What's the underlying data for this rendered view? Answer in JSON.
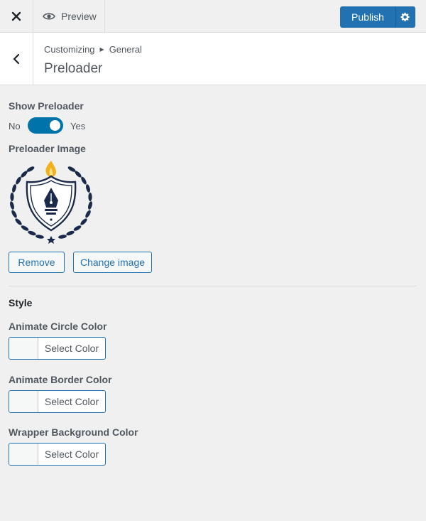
{
  "topbar": {
    "close_icon": "close-icon",
    "preview_label": "Preview",
    "preview_icon": "eye-icon",
    "publish_label": "Publish",
    "settings_icon": "gear-icon"
  },
  "header": {
    "breadcrumb": [
      "Customizing",
      "General"
    ],
    "title": "Preloader",
    "back_icon": "chevron-left-icon"
  },
  "preloader": {
    "show_label": "Show Preloader",
    "toggle_off": "No",
    "toggle_on": "Yes",
    "enabled": true,
    "image_label": "Preloader Image",
    "remove_label": "Remove",
    "change_label": "Change image"
  },
  "style": {
    "heading": "Style",
    "fields": [
      {
        "label": "Animate Circle Color",
        "button": "Select Color"
      },
      {
        "label": "Animate Border Color",
        "button": "Select Color"
      },
      {
        "label": "Wrapper Background Color",
        "button": "Select Color"
      }
    ]
  },
  "colors": {
    "accent": "#2271b1",
    "toggle": "#0073aa",
    "logo_navy": "#1c2a4a",
    "flame": "#f2b21b"
  }
}
